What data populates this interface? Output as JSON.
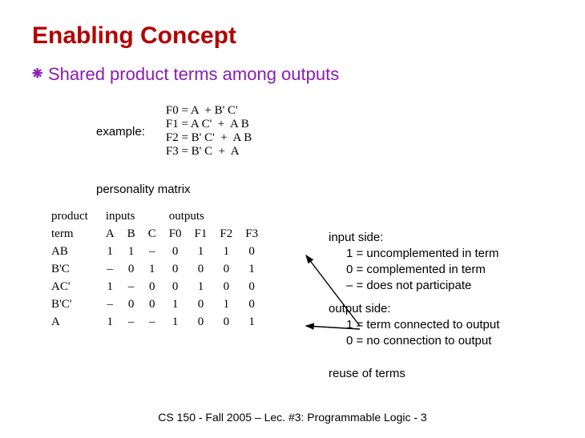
{
  "title": "Enabling Concept",
  "bullet": "Shared product terms among outputs",
  "bullet_glyph": "❋",
  "example_label": "example:",
  "equations": [
    "F0 = A  + B' C'",
    "F1 = A C'  +  A B",
    "F2 = B' C'  +  A B",
    "F3 = B' C  +  A"
  ],
  "personality_label": "personality matrix",
  "col_group_left": "product",
  "col_group_left2": "term",
  "col_group_inputs": "inputs",
  "col_group_outputs": "outputs",
  "cols_inputs": [
    "A",
    "B",
    "C"
  ],
  "cols_outputs": [
    "F0",
    "F1",
    "F2",
    "F3"
  ],
  "rows": [
    {
      "term": "AB",
      "in": [
        "1",
        "1",
        "–"
      ],
      "out": [
        "0",
        "1",
        "1",
        "0"
      ]
    },
    {
      "term": "B'C",
      "in": [
        "–",
        "0",
        "1"
      ],
      "out": [
        "0",
        "0",
        "0",
        "1"
      ]
    },
    {
      "term": "AC'",
      "in": [
        "1",
        "–",
        "0"
      ],
      "out": [
        "0",
        "1",
        "0",
        "0"
      ]
    },
    {
      "term": "B'C'",
      "in": [
        "–",
        "0",
        "0"
      ],
      "out": [
        "1",
        "0",
        "1",
        "0"
      ]
    },
    {
      "term": "A",
      "in": [
        "1",
        "–",
        "–"
      ],
      "out": [
        "1",
        "0",
        "0",
        "1"
      ]
    }
  ],
  "input_side": {
    "hdr": "input side:",
    "lines": [
      "1 = uncomplemented in term",
      "0 = complemented in term",
      "– = does not participate"
    ]
  },
  "output_side": {
    "hdr": "output side:",
    "lines": [
      "1 = term connected to output",
      "0 = no connection to output"
    ]
  },
  "reuse_label": "reuse of terms",
  "footer": "CS 150 - Fall 2005 – Lec. #3: Programmable Logic - 3"
}
